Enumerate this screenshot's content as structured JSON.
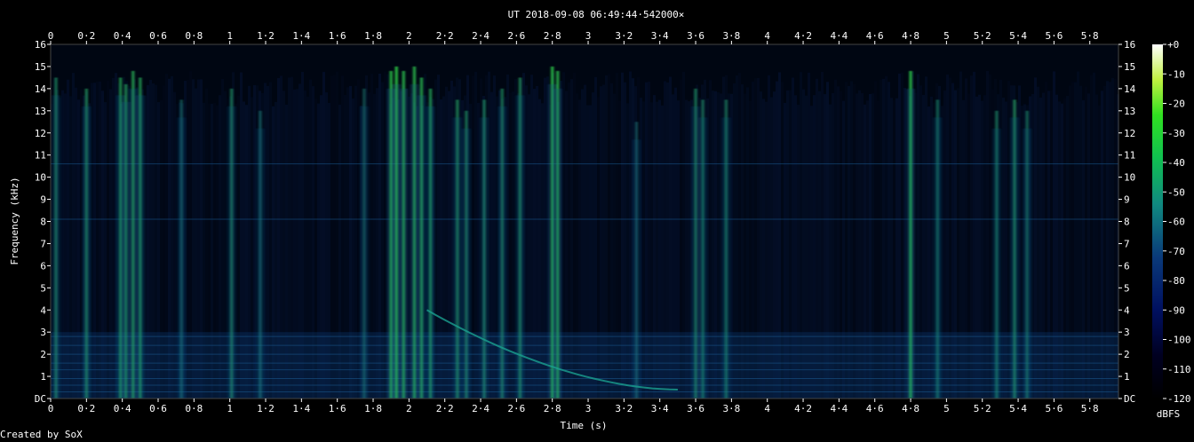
{
  "chart_data": {
    "type": "heatmap",
    "title": "UT 2018-09-08 06:49:44·542000×",
    "xlabel": "Time (s)",
    "ylabel": "Frequency (kHz)",
    "xlim": [
      0,
      5.96
    ],
    "ylim": [
      0,
      16
    ],
    "x_ticks": [
      "0",
      "0·2",
      "0·4",
      "0·6",
      "0·8",
      "1",
      "1·2",
      "1·4",
      "1·6",
      "1·8",
      "2",
      "2·2",
      "2·4",
      "2·6",
      "2·8",
      "3",
      "3·2",
      "3·4",
      "3·6",
      "3·8",
      "4",
      "4·2",
      "4·4",
      "4·6",
      "4·8",
      "5",
      "5·2",
      "5·4",
      "5·6",
      "5·8"
    ],
    "y_ticks": [
      "DC",
      "1",
      "2",
      "3",
      "4",
      "5",
      "6",
      "7",
      "8",
      "9",
      "10",
      "11",
      "12",
      "13",
      "14",
      "15",
      "16"
    ],
    "colorbar": {
      "label": "dBFS",
      "ticks": [
        "+0",
        "-10",
        "-20",
        "-30",
        "-40",
        "-50",
        "-60",
        "-70",
        "-80",
        "-90",
        "-100",
        "-110",
        "-120"
      ],
      "range": [
        -120,
        0
      ]
    },
    "events": [
      {
        "t": 0.03,
        "fmax": 14.5,
        "i": 0.55
      },
      {
        "t": 0.2,
        "fmax": 14.0,
        "i": 0.6
      },
      {
        "t": 0.39,
        "fmax": 14.5,
        "i": 0.7
      },
      {
        "t": 0.42,
        "fmax": 14.2,
        "i": 0.65
      },
      {
        "t": 0.46,
        "fmax": 14.8,
        "i": 0.75
      },
      {
        "t": 0.5,
        "fmax": 14.5,
        "i": 0.7
      },
      {
        "t": 0.73,
        "fmax": 13.5,
        "i": 0.35
      },
      {
        "t": 1.01,
        "fmax": 14.0,
        "i": 0.55
      },
      {
        "t": 1.17,
        "fmax": 13.0,
        "i": 0.35
      },
      {
        "t": 1.75,
        "fmax": 14.0,
        "i": 0.35
      },
      {
        "t": 1.9,
        "fmax": 14.8,
        "i": 0.9
      },
      {
        "t": 1.93,
        "fmax": 15.0,
        "i": 0.95
      },
      {
        "t": 1.97,
        "fmax": 14.8,
        "i": 0.85
      },
      {
        "t": 2.03,
        "fmax": 15.0,
        "i": 0.85
      },
      {
        "t": 2.07,
        "fmax": 14.5,
        "i": 0.8
      },
      {
        "t": 2.12,
        "fmax": 14.0,
        "i": 0.7
      },
      {
        "t": 2.27,
        "fmax": 13.5,
        "i": 0.6
      },
      {
        "t": 2.32,
        "fmax": 13.0,
        "i": 0.55
      },
      {
        "t": 2.42,
        "fmax": 13.5,
        "i": 0.55
      },
      {
        "t": 2.52,
        "fmax": 14.0,
        "i": 0.55
      },
      {
        "t": 2.62,
        "fmax": 14.5,
        "i": 0.6
      },
      {
        "t": 2.8,
        "fmax": 15.0,
        "i": 0.9
      },
      {
        "t": 2.83,
        "fmax": 14.8,
        "i": 0.85
      },
      {
        "t": 3.27,
        "fmax": 12.5,
        "i": 0.3
      },
      {
        "t": 3.6,
        "fmax": 14.0,
        "i": 0.55
      },
      {
        "t": 3.64,
        "fmax": 13.5,
        "i": 0.5
      },
      {
        "t": 3.77,
        "fmax": 13.5,
        "i": 0.5
      },
      {
        "t": 4.8,
        "fmax": 14.8,
        "i": 0.9
      },
      {
        "t": 4.95,
        "fmax": 13.5,
        "i": 0.45
      },
      {
        "t": 5.28,
        "fmax": 13.0,
        "i": 0.5
      },
      {
        "t": 5.38,
        "fmax": 13.5,
        "i": 0.6
      },
      {
        "t": 5.45,
        "fmax": 13.0,
        "i": 0.45
      }
    ],
    "whistler": {
      "t_start": 2.1,
      "f_start": 4.0,
      "t_end": 3.5,
      "f_end": 0.4
    },
    "bands_khz": [
      0.3,
      0.6,
      0.9,
      1.3,
      1.6,
      2.0,
      2.4,
      2.8,
      8.1,
      10.6
    ]
  },
  "footer": {
    "credit": "Created by SoX"
  }
}
